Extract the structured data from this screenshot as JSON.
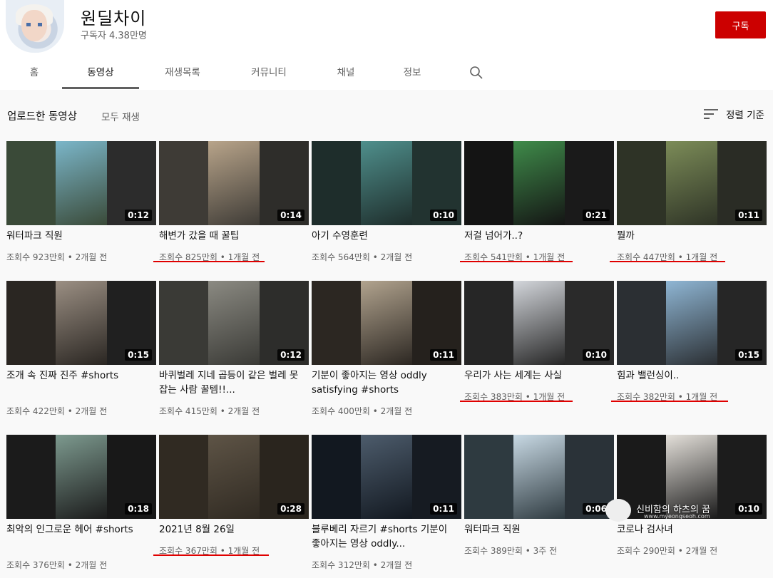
{
  "channel": {
    "name": "원딜차이",
    "subscribers": "구독자 4.38만명",
    "subscribe_label": "구독"
  },
  "tabs": [
    "홈",
    "동영상",
    "재생목록",
    "커뮤니티",
    "채널",
    "정보"
  ],
  "section": {
    "title": "업로드한 동영상",
    "play_all": "모두 재생",
    "sort_label": "정렬 기준"
  },
  "videos": [
    {
      "title": "워터파크 직원",
      "meta": "조회수 923만회 • 2개월 전",
      "duration": "0:12"
    },
    {
      "title": "해변가 갔을 때 꿀팁",
      "meta": "조회수 825만회 • 1개월 전",
      "duration": "0:14"
    },
    {
      "title": "아기 수영훈련",
      "meta": "조회수 564만회 • 2개월 전",
      "duration": "0:10"
    },
    {
      "title": "저걸 넘어가..?",
      "meta": "조회수 541만회 • 1개월 전",
      "duration": "0:21"
    },
    {
      "title": "뭘까",
      "meta": "조회수 447만회 • 1개월 전",
      "duration": "0:11"
    },
    {
      "title": "조개 속 진짜 진주 #shorts",
      "meta": "조회수 422만회 • 2개월 전",
      "duration": "0:15"
    },
    {
      "title": "바퀴벌레 지네 곱등이 같은 벌레 못잡는 사람 꿀템!!...",
      "meta": "조회수 415만회 • 2개월 전",
      "duration": "0:12"
    },
    {
      "title": "기분이 좋아지는 영상 oddly satisfying #shorts",
      "meta": "조회수 400만회 • 2개월 전",
      "duration": "0:11"
    },
    {
      "title": "우리가 사는 세계는 사실",
      "meta": "조회수 383만회 • 1개월 전",
      "duration": "0:10"
    },
    {
      "title": "힘과 밸런싱이..",
      "meta": "조회수 382만회 • 1개월 전",
      "duration": "0:15"
    },
    {
      "title": "최악의 인그로운 헤어 #shorts",
      "meta": "조회수 376만회 • 2개월 전",
      "duration": "0:18"
    },
    {
      "title": "2021년 8월 26일",
      "meta": "조회수 367만회 • 1개월 전",
      "duration": "0:28"
    },
    {
      "title": "블루베리 자르기 #shorts 기분이 좋아지는 영상 oddly...",
      "meta": "조회수 312만회 • 2개월 전",
      "duration": "0:11"
    },
    {
      "title": "워터파크 직원",
      "meta": "조회수 389만회 • 3주 전",
      "duration": "0:06"
    },
    {
      "title": "코로나 검사녀",
      "meta": "조회수 290만회 • 2개월 전",
      "duration": "0:10"
    }
  ],
  "watermark": {
    "text": "신비함의 하츠의 꿈",
    "url": "www.myeongseoh.com"
  },
  "colors": {
    "subscribe": "#cc0000",
    "annotation_underline": "#e00000",
    "tab_indicator": "#606060"
  }
}
